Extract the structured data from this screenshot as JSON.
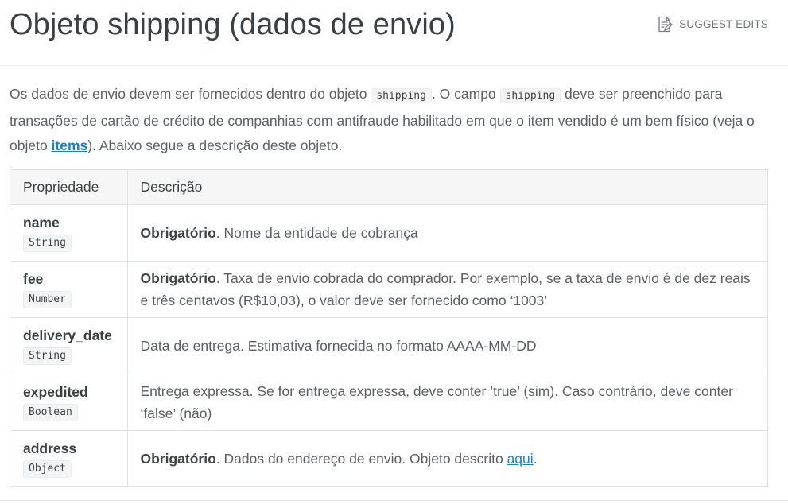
{
  "page": {
    "title": "Objeto shipping (dados de envio)",
    "suggest_edits": "SUGGEST EDITS",
    "suggest_icon": "edit-document-icon"
  },
  "intro": {
    "part1": "Os dados de envio devem ser fornecidos dentro do objeto ",
    "code1": "shipping",
    "part2": ". O campo ",
    "code2": "shipping",
    "part3": " deve ser preenchido para transações de cartão de crédito de companhias com antifraude habilitado em que o item vendido é um bem físico (veja o objeto ",
    "link": "items",
    "part4": "). Abaixo segue a descrição deste objeto."
  },
  "table": {
    "headers": [
      "Propriedade",
      "Descrição"
    ],
    "rows": [
      {
        "name": "name",
        "type": "String",
        "bold": "Obrigatório",
        "text": ". Nome da entidade de cobrança"
      },
      {
        "name": "fee",
        "type": "Number",
        "bold": "Obrigatório",
        "text": ". Taxa de envio cobrada do comprador. Por exemplo, se a taxa de envio é de dez reais e três centavos (R$10,03), o valor deve ser fornecido como ‘1003’"
      },
      {
        "name": "delivery_date",
        "type": "String",
        "bold": "",
        "text": "Data de entrega. Estimativa fornecida no formato AAAA-MM-DD"
      },
      {
        "name": "expedited",
        "type": "Boolean",
        "bold": "",
        "text": "Entrega expressa. Se for entrega expressa, deve conter ’true’ (sim). Caso contrário, deve conter ‘false’ (não)"
      },
      {
        "name": "address",
        "type": "Object",
        "bold": "Obrigatório",
        "text": ". Dados do endereço de envio. Objeto descrito ",
        "link": "aqui",
        "after": "."
      }
    ]
  }
}
